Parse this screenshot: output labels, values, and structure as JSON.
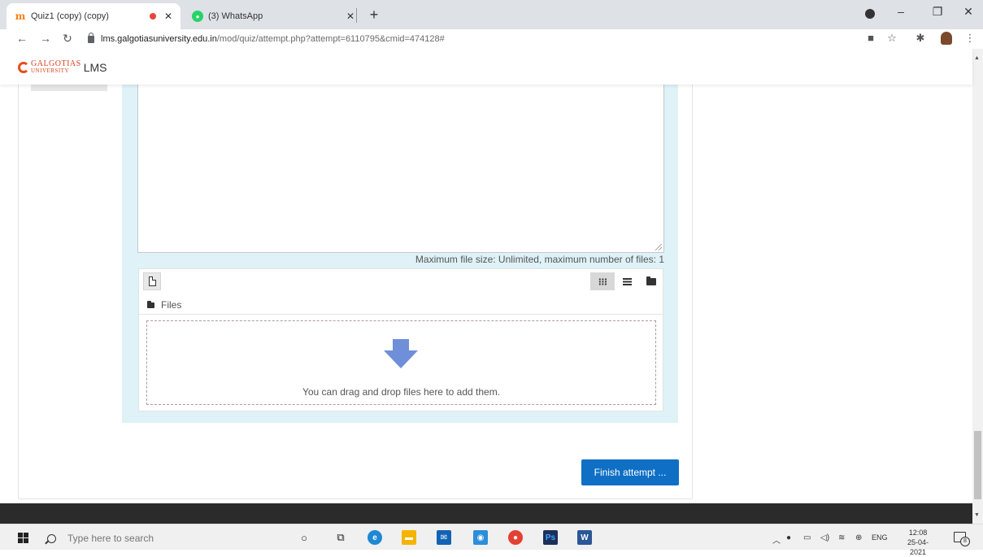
{
  "browser": {
    "tabs": [
      {
        "title": "Quiz1 (copy) (copy)",
        "icon": "moodle-icon",
        "active": true
      },
      {
        "title": "(3) WhatsApp",
        "icon": "whatsapp-icon",
        "active": false
      }
    ],
    "new_tab": "+",
    "url_host": "lms.galgotiasuniversity.edu.in",
    "url_path": "/mod/quiz/attempt.php?attempt=6110795&cmid=474128#",
    "colors": {
      "tabstrip": "#dee1e6",
      "recording": "#e8453c"
    }
  },
  "site": {
    "logo_line1": "GALGOTIAS",
    "logo_line2": "UNIVERSITY",
    "logo_lms": "LMS"
  },
  "question": {
    "max_size_text": "Maximum file size: Unlimited, maximum number of files: 1",
    "filepicker": {
      "path_label": "Files",
      "drop_text": "You can drag and drop files here to add them."
    }
  },
  "actions": {
    "finish_label": "Finish attempt ...",
    "accent": "#0f6fc5"
  },
  "taskbar": {
    "search_placeholder": "Type here to search",
    "lang": "ENG",
    "time": "12:08",
    "date": "25-04-2021",
    "notifications": "8"
  }
}
